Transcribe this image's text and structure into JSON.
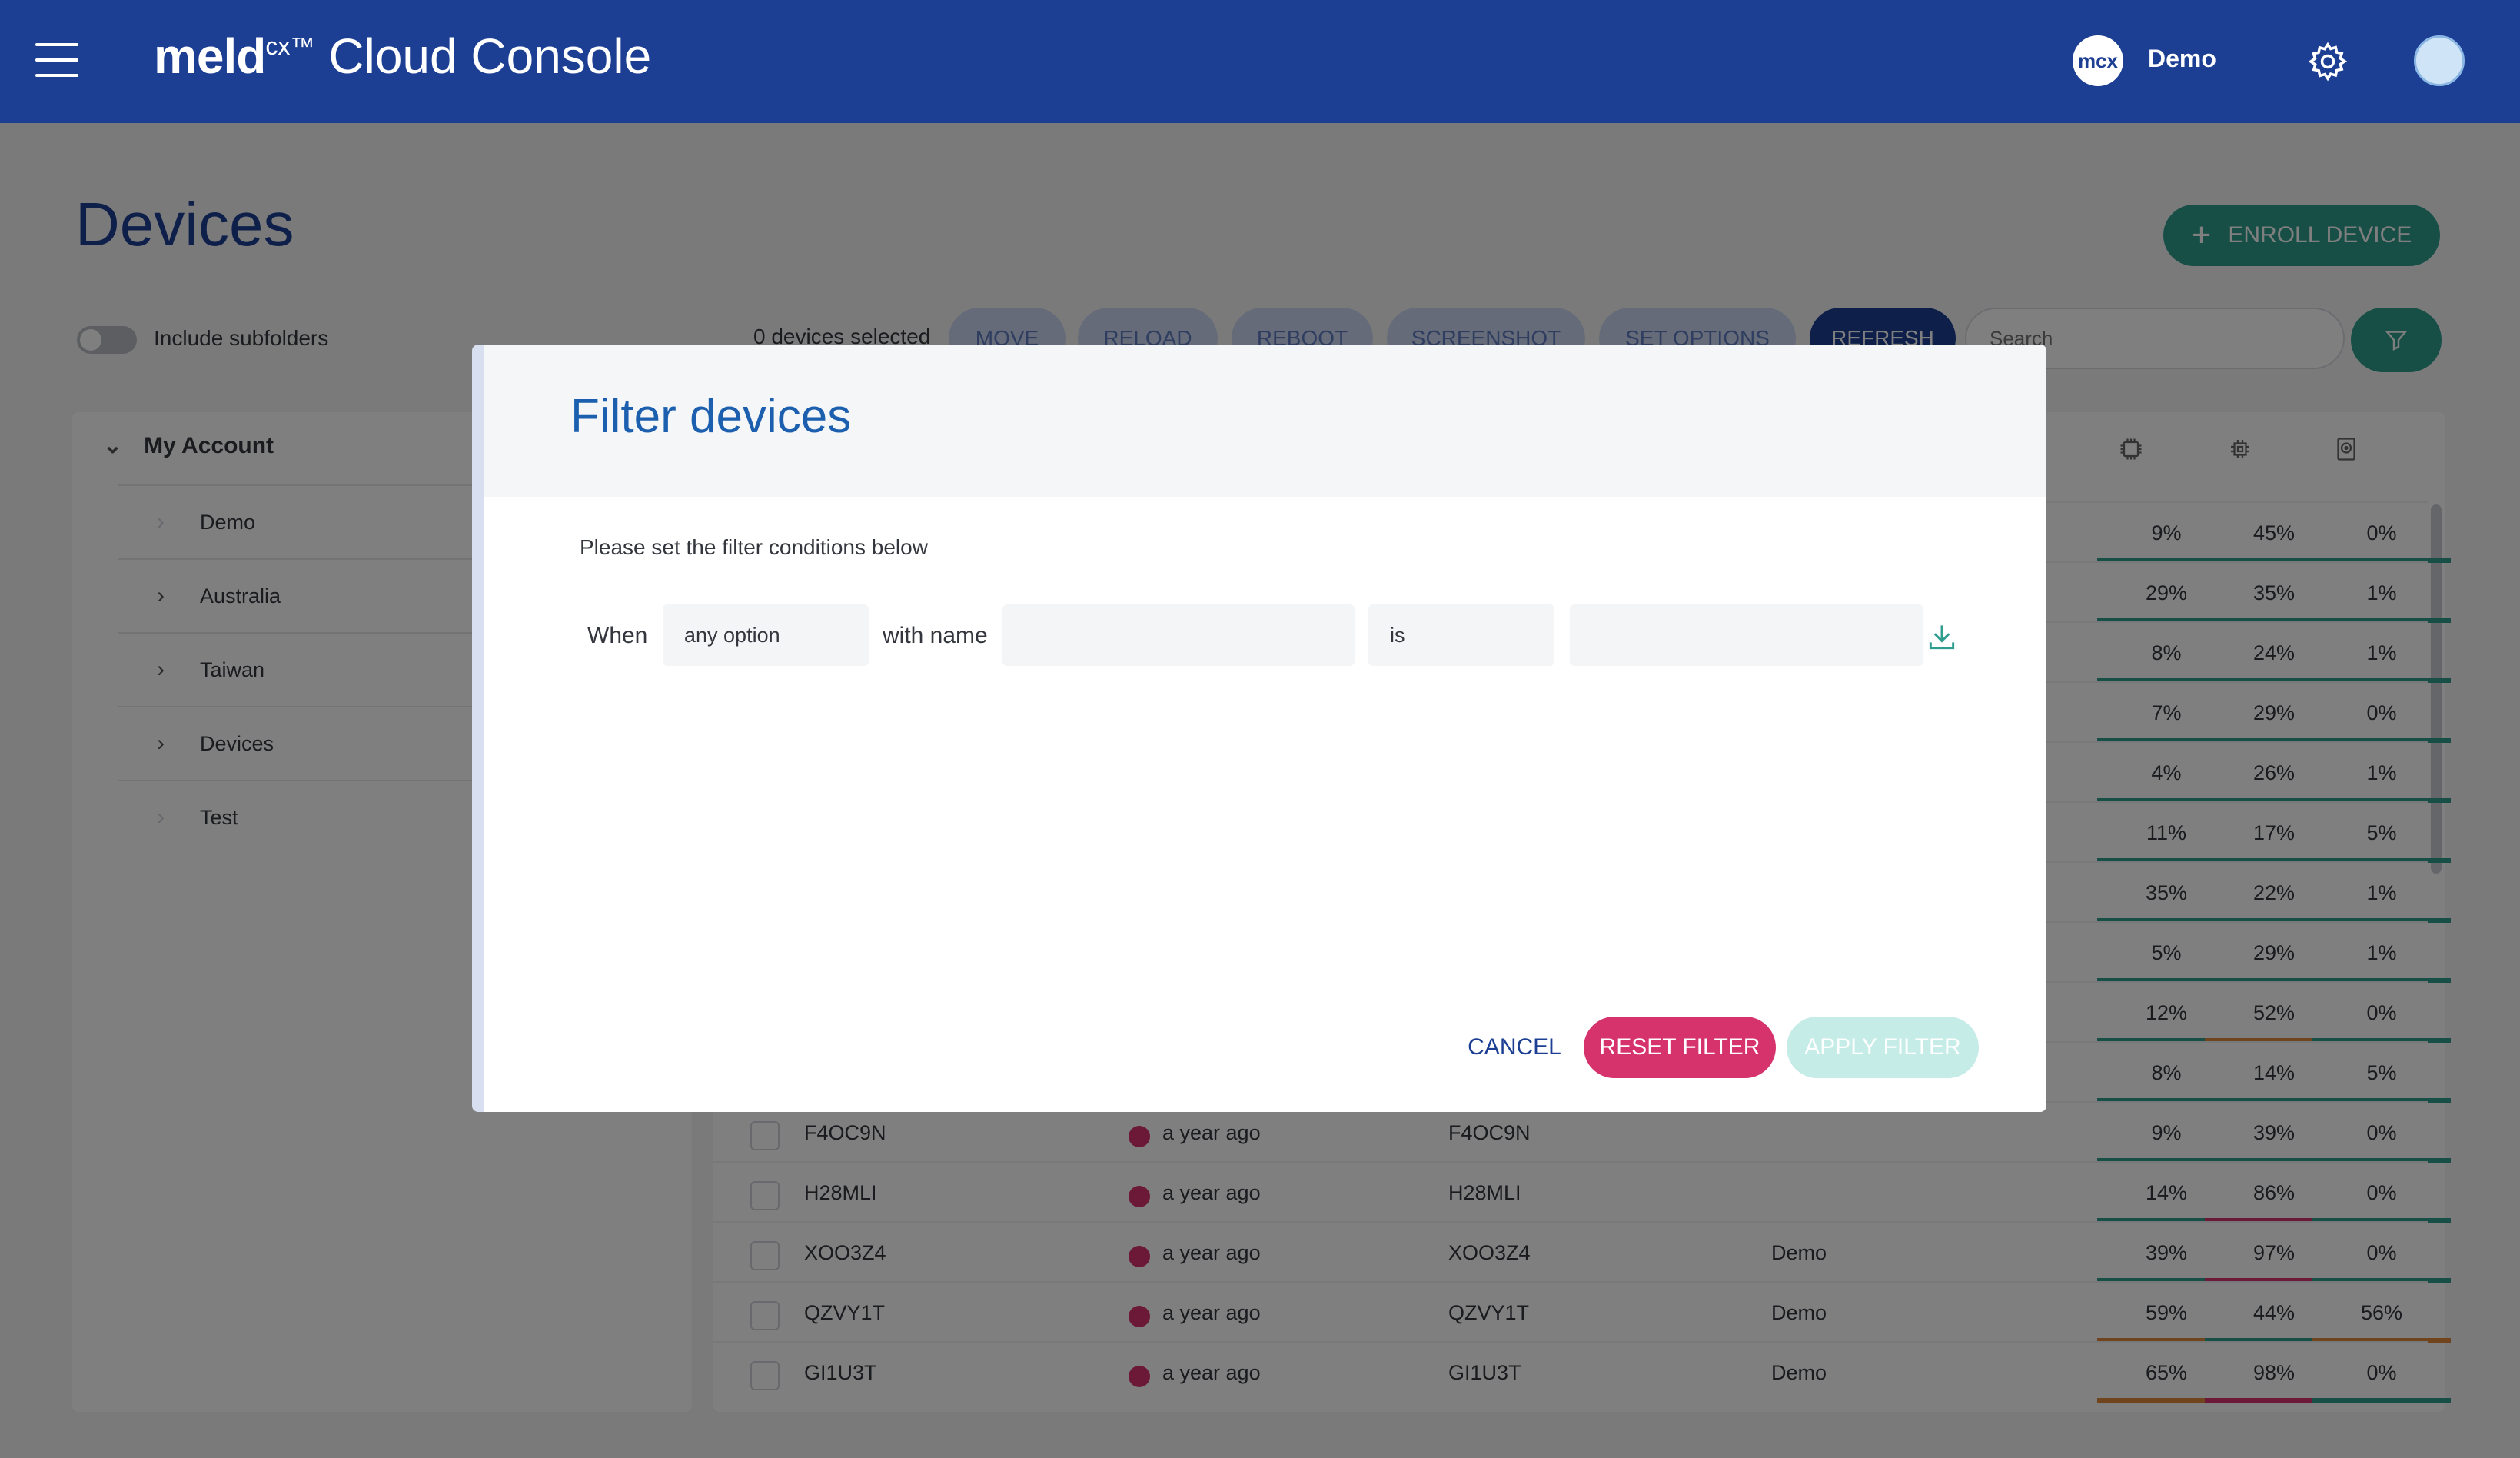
{
  "header": {
    "brand_logo": "meld",
    "brand_sup": "cx™",
    "brand_title": "Cloud Console",
    "org_avatar_text": "mcx",
    "org_name": "Demo"
  },
  "page": {
    "title": "Devices",
    "enroll_label": "ENROLL DEVICE",
    "include_subfolders_label": "Include subfolders",
    "include_subfolders_on": false,
    "selected_text": "0 devices selected",
    "actions": [
      {
        "label": "MOVE"
      },
      {
        "label": "RELOAD"
      },
      {
        "label": "REBOOT"
      },
      {
        "label": "SCREENSHOT"
      },
      {
        "label": "SET OPTIONS"
      },
      {
        "label": "REFRESH"
      }
    ],
    "search_placeholder": "Search"
  },
  "sidebar": {
    "root_label": "My Account",
    "items": [
      {
        "label": "Demo",
        "expandable": false
      },
      {
        "label": "Australia",
        "expandable": true
      },
      {
        "label": "Taiwan",
        "expandable": true
      },
      {
        "label": "Devices",
        "expandable": true
      },
      {
        "label": "Test",
        "expandable": false
      }
    ]
  },
  "table": {
    "metric_columns": [
      "cpu-icon",
      "memory-icon",
      "storage-icon"
    ],
    "hidden_metric_rows": [
      {
        "cpu": "9%",
        "mem": "45%",
        "disk": "0%"
      },
      {
        "cpu": "29%",
        "mem": "35%",
        "disk": "1%"
      },
      {
        "cpu": "8%",
        "mem": "24%",
        "disk": "1%"
      },
      {
        "cpu": "7%",
        "mem": "29%",
        "disk": "0%"
      },
      {
        "cpu": "4%",
        "mem": "26%",
        "disk": "1%"
      },
      {
        "cpu": "11%",
        "mem": "17%",
        "disk": "5%"
      },
      {
        "cpu": "35%",
        "mem": "22%",
        "disk": "1%"
      },
      {
        "cpu": "5%",
        "mem": "29%",
        "disk": "1%"
      },
      {
        "cpu": "12%",
        "mem": "52%",
        "disk": "0%"
      },
      {
        "cpu": "8%",
        "mem": "14%",
        "disk": "5%"
      }
    ],
    "rows": [
      {
        "name": "F4OC9N",
        "status_time": "a year ago",
        "serial": "F4OC9N",
        "folder": "",
        "cpu": "9%",
        "mem": "39%",
        "disk": "0%"
      },
      {
        "name": "H28MLI",
        "status_time": "a year ago",
        "serial": "H28MLI",
        "folder": "",
        "cpu": "14%",
        "mem": "86%",
        "disk": "0%"
      },
      {
        "name": "XOO3Z4",
        "status_time": "a year ago",
        "serial": "XOO3Z4",
        "folder": "Demo",
        "cpu": "39%",
        "mem": "97%",
        "disk": "0%"
      },
      {
        "name": "QZVY1T",
        "status_time": "a year ago",
        "serial": "QZVY1T",
        "folder": "Demo",
        "cpu": "59%",
        "mem": "44%",
        "disk": "56%"
      },
      {
        "name": "GI1U3T",
        "status_time": "a year ago",
        "serial": "GI1U3T",
        "folder": "Demo",
        "cpu": "65%",
        "mem": "98%",
        "disk": "0%"
      }
    ]
  },
  "colors": {
    "header_bg": "#1c3f94",
    "teal": "#2f9e8f",
    "pink": "#d6336c",
    "orange": "#e08a3c",
    "offline_dot": "#d6336c"
  },
  "modal": {
    "title": "Filter devices",
    "subtitle": "Please set the filter conditions below",
    "when_label": "When",
    "option_value": "any option",
    "with_name_label": "with name",
    "name_value": "",
    "operator_value": "is",
    "match_value": "",
    "cancel_label": "CANCEL",
    "reset_label": "RESET FILTER",
    "apply_label": "APPLY FILTER"
  }
}
